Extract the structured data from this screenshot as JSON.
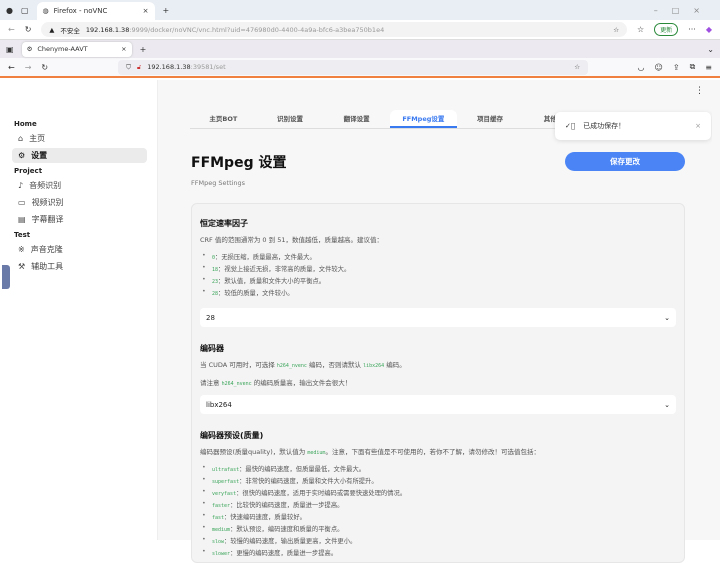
{
  "edge": {
    "tab_title": "Firefox - noVNC",
    "insecure": "不安全",
    "url_host": "192.168.1.38",
    "url_rest": ":9999/docker/noVNC/vnc.html?uid=476980d0-4400-4a9a-bfc6-a3bea750b1e4",
    "update": "更新"
  },
  "firefox": {
    "tab_title": "Chenyme-AAVT",
    "url_host": "192.168.1.38",
    "url_rest": ":39581/set"
  },
  "sidebar": {
    "sections": [
      {
        "title": "Home",
        "items": [
          {
            "label": "主页",
            "icon": "⌂"
          },
          {
            "label": "设置",
            "icon": "⚙"
          }
        ]
      },
      {
        "title": "Project",
        "items": [
          {
            "label": "音频识别",
            "icon": "♪"
          },
          {
            "label": "视频识别",
            "icon": "▭"
          },
          {
            "label": "字幕翻译",
            "icon": "▤"
          }
        ]
      },
      {
        "title": "Test",
        "items": [
          {
            "label": "声音克隆",
            "icon": "※"
          },
          {
            "label": "辅助工具",
            "icon": "⚒"
          }
        ]
      }
    ]
  },
  "tabs": [
    "主页BOT",
    "识别设置",
    "翻译设置",
    "FFMpeg设置",
    "项目缓存",
    "其他设置"
  ],
  "toast": {
    "text": "已成功保存！"
  },
  "page": {
    "title": "FFMpeg 设置",
    "subtitle": "FFMpeg Settings",
    "save": "保存更改"
  },
  "crf": {
    "title": "恒定速率因子",
    "desc": "CRF 值的范围通常为 0 到 51，数值越低，质量越高。建议值：",
    "items": [
      {
        "code": "0",
        "text": "：无损压缩，质量最高，文件最大。"
      },
      {
        "code": "18",
        "text": "：视觉上接近无损，非常高的质量，文件较大。"
      },
      {
        "code": "23",
        "text": "：默认值，质量和文件大小的平衡点。"
      },
      {
        "code": "28",
        "text": "：较低的质量，文件较小。"
      }
    ],
    "value": "28"
  },
  "encoder": {
    "title": "编码器",
    "d1a": "当 CUDA 可用时，可选择 ",
    "c1": "h264_nvenc",
    "d1b": " 编码，否则请默认 ",
    "c2": "libx264",
    "d1c": " 编码。",
    "d2a": "请注意 ",
    "c3": "h264_nvenc",
    "d2b": " 的编码质量高，输出文件会很大！",
    "value": "libx264"
  },
  "preset": {
    "title": "编码器预设(质量)",
    "da": "编码器预设(质量quality)，默认值为 ",
    "code": "medium",
    "db": "。注意，下面有些值是不可使用的，若你不了解，请勿修改！可选值包括：",
    "items": [
      {
        "code": "ultrafast",
        "text": "：最快的编码速度，但质量最低，文件最大。"
      },
      {
        "code": "superfast",
        "text": "：非常快的编码速度，质量和文件大小有所提升。"
      },
      {
        "code": "veryfast",
        "text": "：很快的编码速度，适用于实时编码或需要快速处理的情况。"
      },
      {
        "code": "faster",
        "text": "：比较快的编码速度，质量进一步提高。"
      },
      {
        "code": "fast",
        "text": "：快速编码速度，质量较好。"
      },
      {
        "code": "medium",
        "text": "：默认预设，编码速度和质量的平衡点。"
      },
      {
        "code": "slow",
        "text": "：较慢的编码速度，输出质量更高，文件更小。"
      },
      {
        "code": "slower",
        "text": "：更慢的编码速度，质量进一步提高。"
      }
    ]
  }
}
